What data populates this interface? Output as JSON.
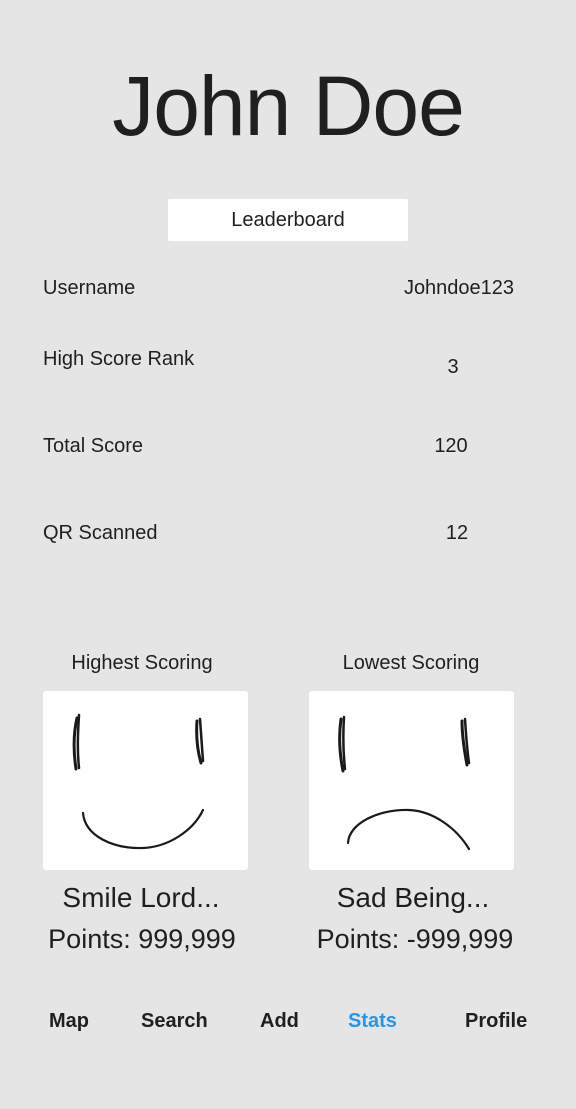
{
  "profile": {
    "name": "John Doe",
    "leaderboard_label": "Leaderboard"
  },
  "stats": [
    {
      "label": "Username",
      "value": "Johndoe123"
    },
    {
      "label": "High Score Rank",
      "value": "3"
    },
    {
      "label": "Total Score",
      "value": "120"
    },
    {
      "label": "QR Scanned",
      "value": "12"
    }
  ],
  "highest": {
    "heading": "Highest Scoring",
    "name": "Smile Lord...",
    "points": "Points: 999,999",
    "icon": "smiley-face-drawing"
  },
  "lowest": {
    "heading": "Lowest Scoring",
    "name": "Sad Being...",
    "points": "Points: -999,999",
    "icon": "sad-face-drawing"
  },
  "nav": {
    "items": [
      "Map",
      "Search",
      "Add",
      "Stats",
      "Profile"
    ],
    "active": "Stats",
    "active_color": "#2196f3"
  },
  "colors": {
    "background": "#e5e5e5",
    "card": "#ffffff",
    "text": "#1f1f1f"
  }
}
